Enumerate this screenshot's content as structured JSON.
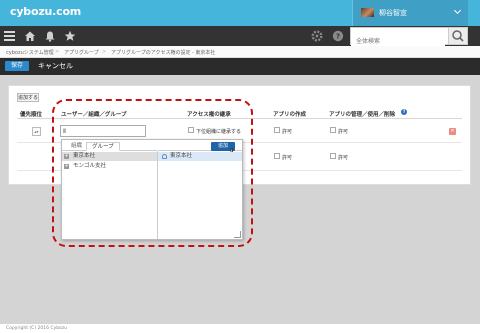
{
  "header": {
    "logo": "cybozu.com",
    "user_name": "柳谷智宣",
    "search_placeholder": "全体検索",
    "brand_color": "#46b5dc"
  },
  "toolbar": {
    "icons": [
      "menu-icon",
      "home-icon",
      "bell-icon",
      "star-icon",
      "gear-icon",
      "help-icon",
      "search-icon"
    ]
  },
  "breadcrumb": [
    "cybozuシステム管理",
    "アプリグループ",
    "アプリグループのアクセス権の設定 - 東京本社"
  ],
  "actions": {
    "save": "保存",
    "cancel": "キャンセル",
    "save_color": "#2b8acd"
  },
  "table": {
    "add_button": "追加する",
    "headers": [
      "優先順位",
      "ユーザー／組織／グループ",
      "アクセス権の継承",
      "アプリの作成",
      "アプリの管理／使用／削除"
    ],
    "inherit_label": "下位組織に継承する",
    "rows": [
      {
        "create": "許可",
        "manage": "許可"
      },
      {
        "create": "許可",
        "manage": "許可"
      }
    ]
  },
  "picker": {
    "tabs": [
      "組織",
      "グループ"
    ],
    "left_items": [
      "東京本社",
      "モンゴル支社"
    ],
    "add_button": "追加",
    "selected_items": [
      "東京本社"
    ]
  },
  "footer": "Copyright (C) 2016 Cybozu"
}
